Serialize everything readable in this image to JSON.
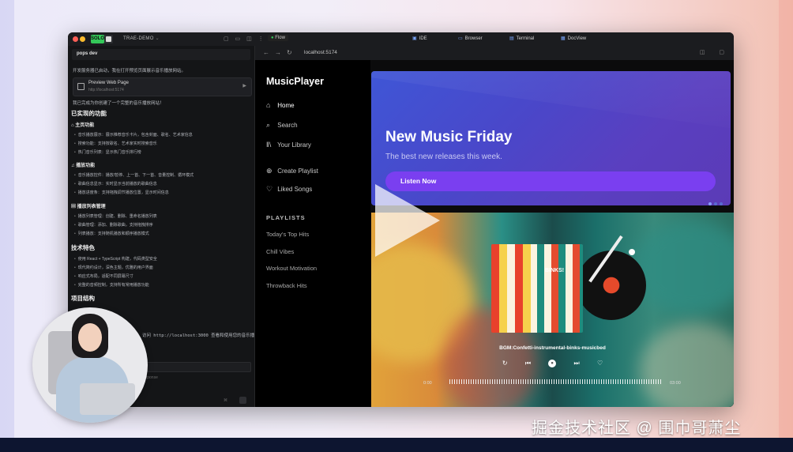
{
  "titlebar": {
    "badge": "SOLO",
    "project": "TRAE-DEMO",
    "flow": "Flow",
    "tabs": [
      "IDE",
      "Browser",
      "Terminal",
      "DocView"
    ]
  },
  "chat": {
    "header": "pops dev",
    "intro": "开发服务器已启动，我在打开预览页面展示音乐播放网站。",
    "preview_card": {
      "title": "Preview Web Page",
      "url": "http://localhost:5174"
    },
    "summary": "我已完成为你创建了一个完整的音乐播放网站！",
    "features_title": "已实现的功能",
    "sections": [
      {
        "title": "主页功能",
        "bullets": [
          "音乐播放展示：展示推荐音乐卡片，包含封面、歌名、艺术家信息",
          "搜索功能：支持按歌名、艺术家实时搜索音乐",
          "热门音乐列表：显示热门音乐排行榜"
        ]
      },
      {
        "title": "播放功能",
        "bullets": [
          "音乐播放控件：播放/暂停、上一首、下一首、音量控制、循环模式",
          "歌曲信息显示：实时显示当前播放的歌曲信息",
          "播放进度条：支持拖拽调节播放位置，显示时间信息"
        ]
      },
      {
        "title": "播放列表管理",
        "bullets": [
          "播放列表管理：创建、删除、重命名播放列表",
          "歌曲管理：添加、删除歌曲，支持拖拽排序",
          "列表播放：支持随机播放和顺序播放模式"
        ]
      }
    ],
    "tech_title": "技术特色",
    "tech_bullets": [
      "使用 React + TypeScript 构建，代码类型安全",
      "现代简约设计，深色主题，优雅的用户界面",
      "响应式布局，适配不同屏幕尺寸",
      "完整的音频控制，支持所有常用播放功能"
    ],
    "structure_title": "项目结构",
    "localhost_line": "访问 http://localhost:3000 查看和使用您的音乐播",
    "hint": "ul response"
  },
  "browser": {
    "back": "←",
    "forward": "→",
    "reload": "↻",
    "url": "localhost:5174"
  },
  "app": {
    "brand": "MusicPlayer",
    "nav": [
      {
        "icon": "⌂",
        "label": "Home"
      },
      {
        "icon": "⌕",
        "label": "Search"
      },
      {
        "icon": "‖\\",
        "label": "Your Library"
      },
      {
        "icon": "⊕",
        "label": "Create Playlist"
      },
      {
        "icon": "♡",
        "label": "Liked Songs"
      }
    ],
    "playlists_title": "PLAYLISTS",
    "playlists": [
      "Today's Top Hits",
      "Chill Vibes",
      "Workout Motivation",
      "Throwback Hits"
    ],
    "hero": {
      "title": "New Music Friday",
      "subtitle": "The best new releases this week.",
      "button": "Listen Now"
    },
    "now_playing": {
      "track": "BGM:Confetti-instrumental-binks-musicbed",
      "cover_text": "BINKS!",
      "elapsed": "0:00",
      "duration": "03:00"
    },
    "controls": {
      "repeat": "↻",
      "prev": "⏮",
      "play_pause": "⏸",
      "next": "⏭",
      "like": "♡"
    }
  },
  "watermark": "掘金技术社区 @ 围巾哥萧尘",
  "colors": {
    "accent": "#7a3ff0",
    "hero_start": "#3f56d6",
    "hero_end": "#5b3bb6"
  }
}
